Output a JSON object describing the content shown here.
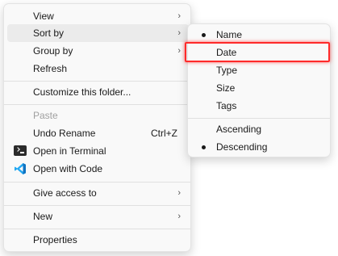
{
  "context_menu": {
    "items": [
      {
        "label": "View",
        "has_submenu": true
      },
      {
        "label": "Sort by",
        "has_submenu": true,
        "active": true
      },
      {
        "label": "Group by",
        "has_submenu": true
      },
      {
        "label": "Refresh"
      },
      {
        "label": "Customize this folder..."
      },
      {
        "label": "Paste",
        "disabled": true
      },
      {
        "label": "Undo Rename",
        "shortcut": "Ctrl+Z"
      },
      {
        "label": "Open in Terminal",
        "icon": "terminal-icon"
      },
      {
        "label": "Open with Code",
        "icon": "vscode-icon"
      },
      {
        "label": "Give access to",
        "has_submenu": true
      },
      {
        "label": "New",
        "has_submenu": true
      },
      {
        "label": "Properties"
      }
    ]
  },
  "sort_submenu": {
    "items": [
      {
        "label": "Name",
        "selected": true
      },
      {
        "label": "Date",
        "highlighted": true
      },
      {
        "label": "Type"
      },
      {
        "label": "Size"
      },
      {
        "label": "Tags"
      },
      {
        "label": "Ascending"
      },
      {
        "label": "Descending",
        "selected": true
      }
    ]
  },
  "chevron_glyph": "›",
  "colors": {
    "menu_bg": "#f9f9f9",
    "hover_bg": "#ebebeb",
    "highlight_outline": "#ff2a2a",
    "vscode_blue": "#23a8f2"
  }
}
